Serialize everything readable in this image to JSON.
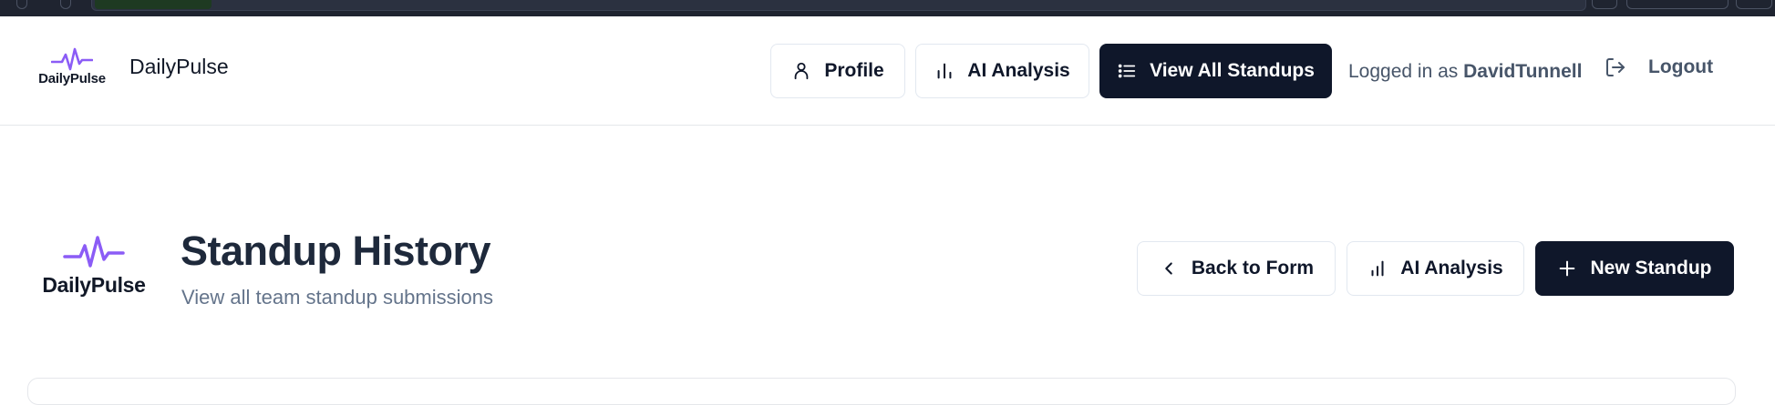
{
  "nav": {
    "brand_logo_text": "DailyPulse",
    "brand_name": "DailyPulse",
    "profile_label": "Profile",
    "ai_analysis_label": "AI Analysis",
    "view_all_label": "View All Standups",
    "logged_in_prefix": "Logged in as",
    "username": "DavidTunnell",
    "logout_label": "Logout"
  },
  "page": {
    "logo_text": "DailyPulse",
    "title": "Standup History",
    "subtitle": "View all team standup submissions",
    "back_label": "Back to Form",
    "ai_analysis_label": "AI Analysis",
    "new_standup_label": "New Standup"
  },
  "colors": {
    "accent_purple": "#8b5cf6",
    "primary_dark": "#0f172a"
  }
}
